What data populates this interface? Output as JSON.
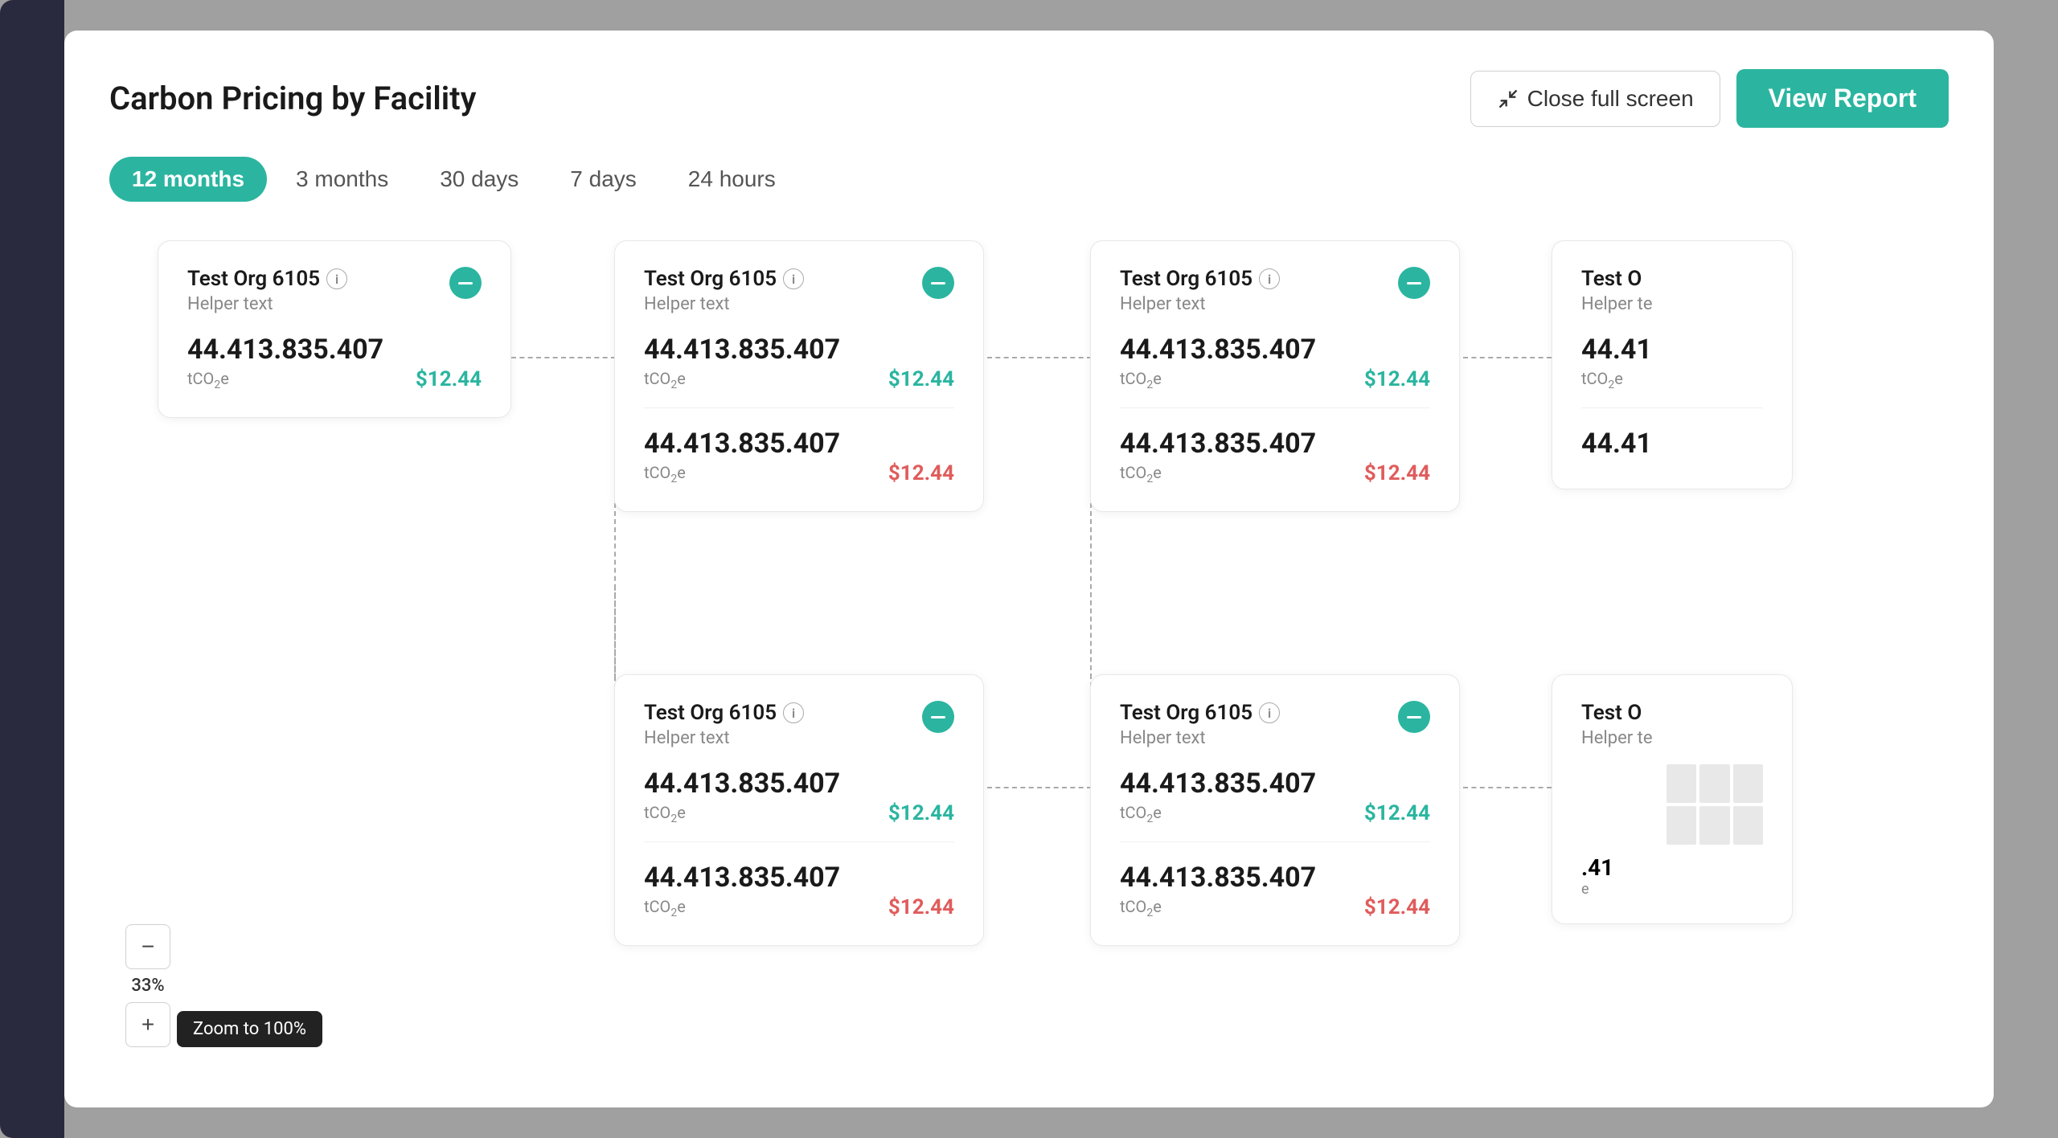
{
  "modal": {
    "title": "Carbon Pricing by Facility"
  },
  "header": {
    "close_label": "Close full screen",
    "view_report_label": "View Report"
  },
  "tabs": [
    {
      "label": "12 months",
      "active": true
    },
    {
      "label": "3 months",
      "active": false
    },
    {
      "label": "30 days",
      "active": false
    },
    {
      "label": "7 days",
      "active": false
    },
    {
      "label": "24 hours",
      "active": false
    }
  ],
  "cards": [
    {
      "id": "card-1",
      "title": "Test Org 6105",
      "helper": "Helper text",
      "metrics": [
        {
          "value": "44.413.835.407",
          "unit": "tCO₂e",
          "price": "$12.44",
          "price_color": "green"
        }
      ]
    },
    {
      "id": "card-2",
      "title": "Test Org 6105",
      "helper": "Helper text",
      "metrics": [
        {
          "value": "44.413.835.407",
          "unit": "tCO₂e",
          "price": "$12.44",
          "price_color": "green"
        },
        {
          "value": "44.413.835.407",
          "unit": "tCO₂e",
          "price": "$12.44",
          "price_color": "red"
        }
      ]
    },
    {
      "id": "card-3",
      "title": "Test Org 6105",
      "helper": "Helper text",
      "metrics": [
        {
          "value": "44.413.835.407",
          "unit": "tCO₂e",
          "price": "$12.44",
          "price_color": "green"
        },
        {
          "value": "44.413.835.407",
          "unit": "tCO₂e",
          "price": "$12.44",
          "price_color": "red"
        }
      ]
    },
    {
      "id": "card-4",
      "title": "Test Org 6105",
      "helper": "Helper text",
      "metrics": [
        {
          "value": "44.413.835.407",
          "unit": "tCO₂e",
          "price": "$12.44",
          "price_color": "green"
        },
        {
          "value": "44.413.835.407",
          "unit": "tCO₂e",
          "price": "$12.44",
          "price_color": "red"
        }
      ]
    },
    {
      "id": "card-5",
      "title": "Test Org 6105",
      "helper": "Helper text",
      "metrics": [
        {
          "value": "44.413.835.407",
          "unit": "tCO₂e",
          "price": "$12.44",
          "price_color": "green"
        },
        {
          "value": "44.413.835.407",
          "unit": "tCO₂e",
          "price": "$12.44",
          "price_color": "red"
        }
      ]
    }
  ],
  "zoom": {
    "percent": "33%",
    "tooltip": "Zoom to 100%",
    "zoom_in_label": "+",
    "zoom_out_label": "−"
  },
  "colors": {
    "teal": "#2bb5a0",
    "red": "#e05c5c",
    "bg": "#f5f5f5"
  }
}
